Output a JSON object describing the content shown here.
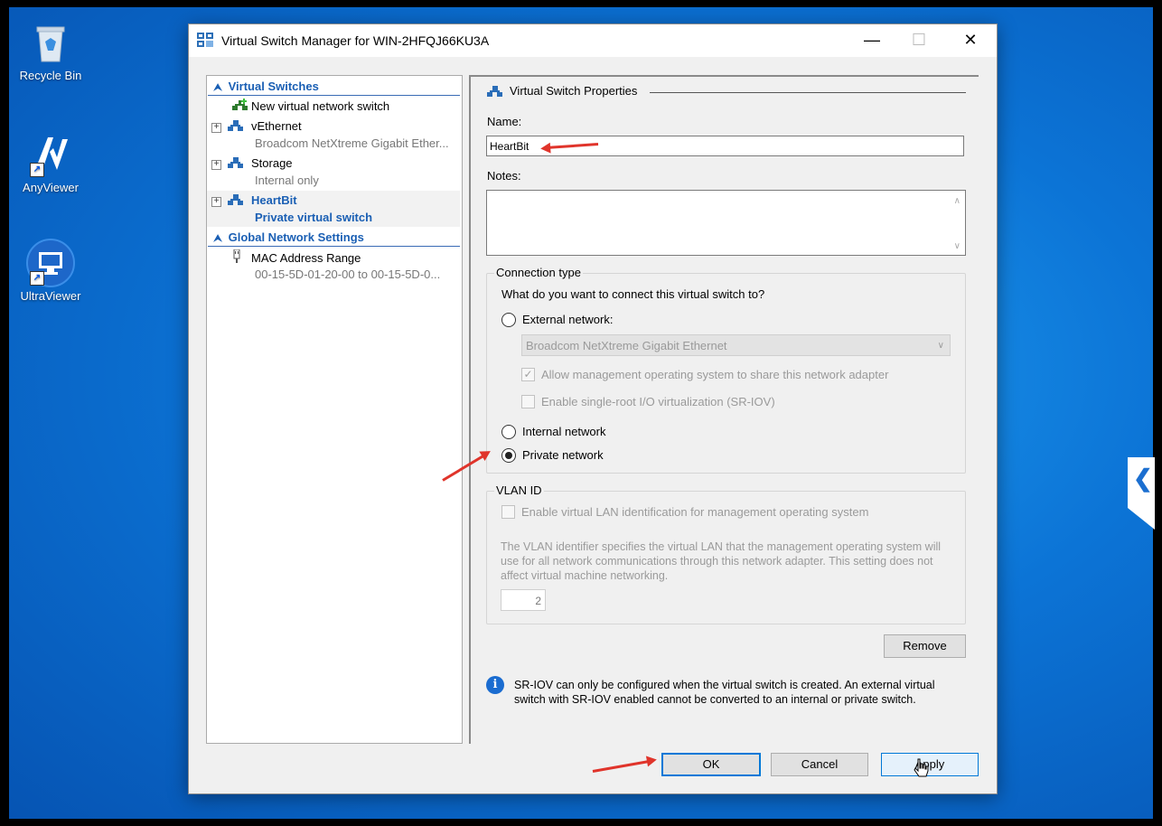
{
  "desktop": {
    "icons": [
      {
        "label": "Recycle Bin"
      },
      {
        "label": "AnyViewer"
      },
      {
        "label": "UltraViewer"
      }
    ]
  },
  "window": {
    "title": "Virtual Switch Manager for WIN-2HFQJ66KU3A",
    "minimize": "—",
    "maximize": "☐",
    "close": "✕"
  },
  "tree": {
    "section_switches": "Virtual Switches",
    "new_switch": "New virtual network switch",
    "items": [
      {
        "name": "vEthernet",
        "sub": "Broadcom NetXtreme Gigabit Ether..."
      },
      {
        "name": "Storage",
        "sub": "Internal only"
      },
      {
        "name": "HeartBit",
        "sub": "Private virtual switch"
      }
    ],
    "section_global": "Global Network Settings",
    "mac_name": "MAC Address Range",
    "mac_sub": "00-15-5D-01-20-00 to 00-15-5D-0..."
  },
  "props": {
    "section_title": "Virtual Switch Properties",
    "name_label": "Name:",
    "name_value": "HeartBit",
    "notes_label": "Notes:",
    "notes_value": "",
    "connection": {
      "title": "Connection type",
      "question": "What do you want to connect this virtual switch to?",
      "external": "External network:",
      "adapter": "Broadcom NetXtreme Gigabit Ethernet",
      "allow_mgmt": "Allow management operating system to share this network adapter",
      "sriov": "Enable single-root I/O virtualization (SR-IOV)",
      "internal": "Internal network",
      "private": "Private network",
      "selected": "private"
    },
    "vlan": {
      "title": "VLAN ID",
      "enable": "Enable virtual LAN identification for management operating system",
      "description": "The VLAN identifier specifies the virtual LAN that the management operating system will use for all network communications through this network adapter. This setting does not affect virtual machine networking.",
      "value": "2"
    },
    "remove": "Remove",
    "info": "SR-IOV can only be configured when the virtual switch is created. An external virtual switch with SR-IOV enabled cannot be converted to an internal or private switch."
  },
  "buttons": {
    "ok": "OK",
    "cancel": "Cancel",
    "apply": "Apply"
  },
  "colors": {
    "accent": "#0078d7",
    "annotation_arrow": "#e0342b",
    "tree_header": "#1a5fb4"
  }
}
